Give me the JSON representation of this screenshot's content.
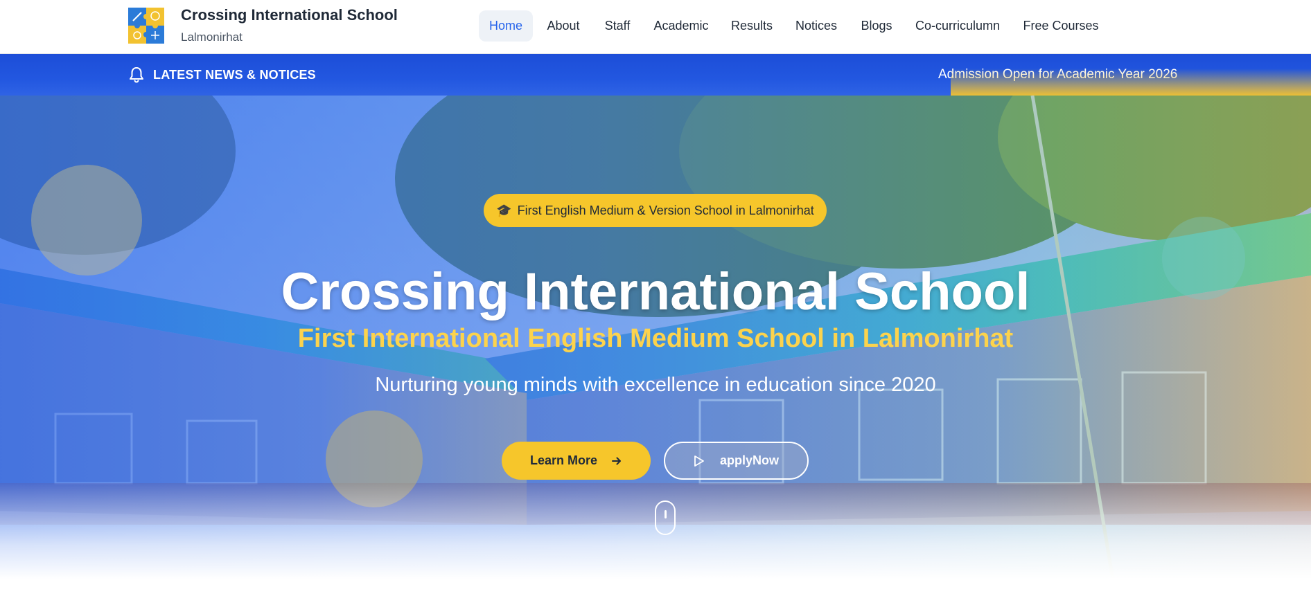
{
  "header": {
    "logo_icon": "puzzle-logo-icon",
    "brand_title": "Crossing International School",
    "brand_subtitle": "Lalmonirhat",
    "nav": [
      {
        "label": "Home",
        "active": true
      },
      {
        "label": "About",
        "active": false
      },
      {
        "label": "Staff",
        "active": false
      },
      {
        "label": "Academic",
        "active": false
      },
      {
        "label": "Results",
        "active": false
      },
      {
        "label": "Notices",
        "active": false
      },
      {
        "label": "Blogs",
        "active": false
      },
      {
        "label": "Co-curriculumn",
        "active": false
      },
      {
        "label": "Free Courses",
        "active": false
      }
    ]
  },
  "ticker": {
    "icon": "bell-icon",
    "label": "LATEST NEWS & NOTICES",
    "text": "Admission Open for Academic Year 2026"
  },
  "hero": {
    "badge_icon": "graduation-cap-icon",
    "badge": "First English Medium & Version School in Lalmonirhat",
    "title": "Crossing International School",
    "subtitle": "First International English Medium School in Lalmonirhat",
    "tagline": "Nurturing young minds with excellence in education since 2020",
    "learn_more": "Learn More",
    "apply_now": "applyNow",
    "scroll_icon": "mouse-scroll-icon"
  },
  "colors": {
    "primary_blue": "#1d4ed8",
    "accent_yellow": "#f6c62b",
    "nav_active": "#2563eb",
    "subtitle_yellow": "#fcd34d"
  }
}
